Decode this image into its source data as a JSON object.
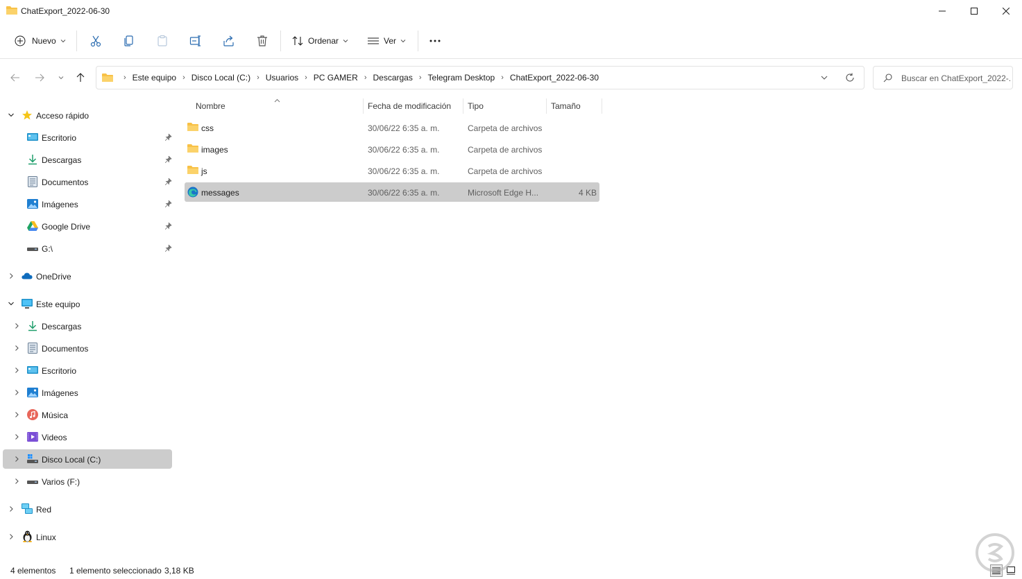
{
  "window": {
    "title": "ChatExport_2022-06-30"
  },
  "toolbar": {
    "new_label": "Nuevo",
    "sort_label": "Ordenar",
    "view_label": "Ver"
  },
  "address": {
    "crumbs": [
      "Este equipo",
      "Disco Local (C:)",
      "Usuarios",
      "PC GAMER",
      "Descargas",
      "Telegram Desktop",
      "ChatExport_2022-06-30"
    ]
  },
  "search": {
    "placeholder": "Buscar en ChatExport_2022-..."
  },
  "sidebar": {
    "quick_access": {
      "label": "Acceso rápido",
      "items": [
        {
          "label": "Escritorio"
        },
        {
          "label": "Descargas"
        },
        {
          "label": "Documentos"
        },
        {
          "label": "Imágenes"
        },
        {
          "label": "Google Drive"
        },
        {
          "label": "G:\\"
        }
      ]
    },
    "onedrive": {
      "label": "OneDrive"
    },
    "this_pc": {
      "label": "Este equipo",
      "items": [
        {
          "label": "Descargas"
        },
        {
          "label": "Documentos"
        },
        {
          "label": "Escritorio"
        },
        {
          "label": "Imágenes"
        },
        {
          "label": "Música"
        },
        {
          "label": "Videos"
        },
        {
          "label": "Disco Local (C:)"
        },
        {
          "label": "Varios (F:)"
        }
      ]
    },
    "network": {
      "label": "Red"
    },
    "linux": {
      "label": "Linux"
    }
  },
  "columns": {
    "name": "Nombre",
    "modified": "Fecha de modificación",
    "type": "Tipo",
    "size": "Tamaño"
  },
  "files": [
    {
      "name": "css",
      "modified": "30/06/22 6:35 a. m.",
      "type": "Carpeta de archivos",
      "size": ""
    },
    {
      "name": "images",
      "modified": "30/06/22 6:35 a. m.",
      "type": "Carpeta de archivos",
      "size": ""
    },
    {
      "name": "js",
      "modified": "30/06/22 6:35 a. m.",
      "type": "Carpeta de archivos",
      "size": ""
    },
    {
      "name": "messages",
      "modified": "30/06/22 6:35 a. m.",
      "type": "Microsoft Edge H...",
      "size": "4 KB"
    }
  ],
  "status": {
    "count": "4 elementos",
    "selection": "1 elemento seleccionado",
    "selection_size": "3,18 KB"
  },
  "colors": {
    "folder": "#f8c146",
    "selection": "#cccccc",
    "accent": "#0067c0"
  }
}
